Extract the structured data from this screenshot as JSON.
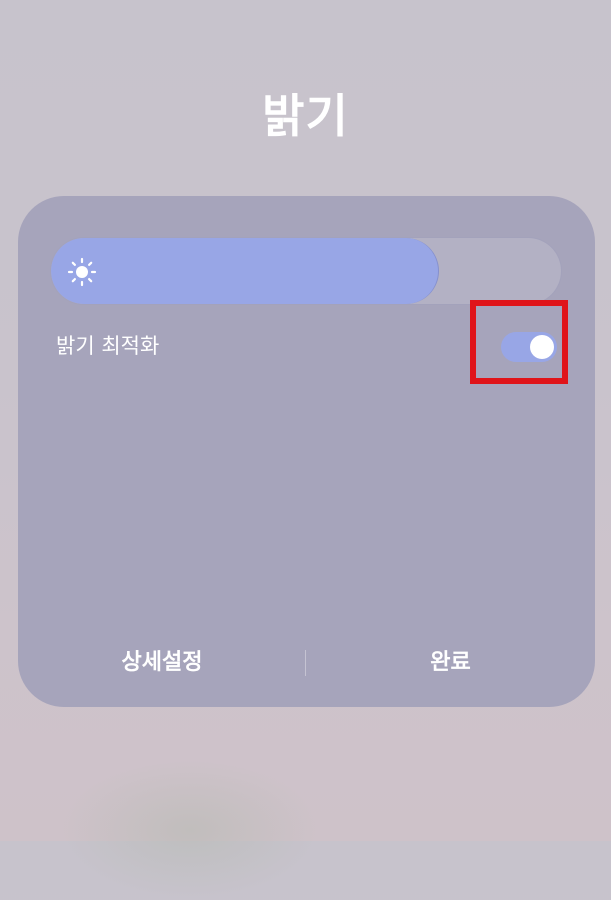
{
  "dialog": {
    "title": "밝기",
    "brightness": {
      "level": 0.76,
      "icon": "sun-icon"
    },
    "auto_brightness": {
      "label": "밝기 최적화",
      "enabled": true
    },
    "buttons": {
      "detail_settings": "상세설정",
      "done": "완료"
    }
  },
  "colors": {
    "accent": "#98a6e6",
    "panel": "#a6a4bb",
    "highlight": "#e0141a"
  }
}
